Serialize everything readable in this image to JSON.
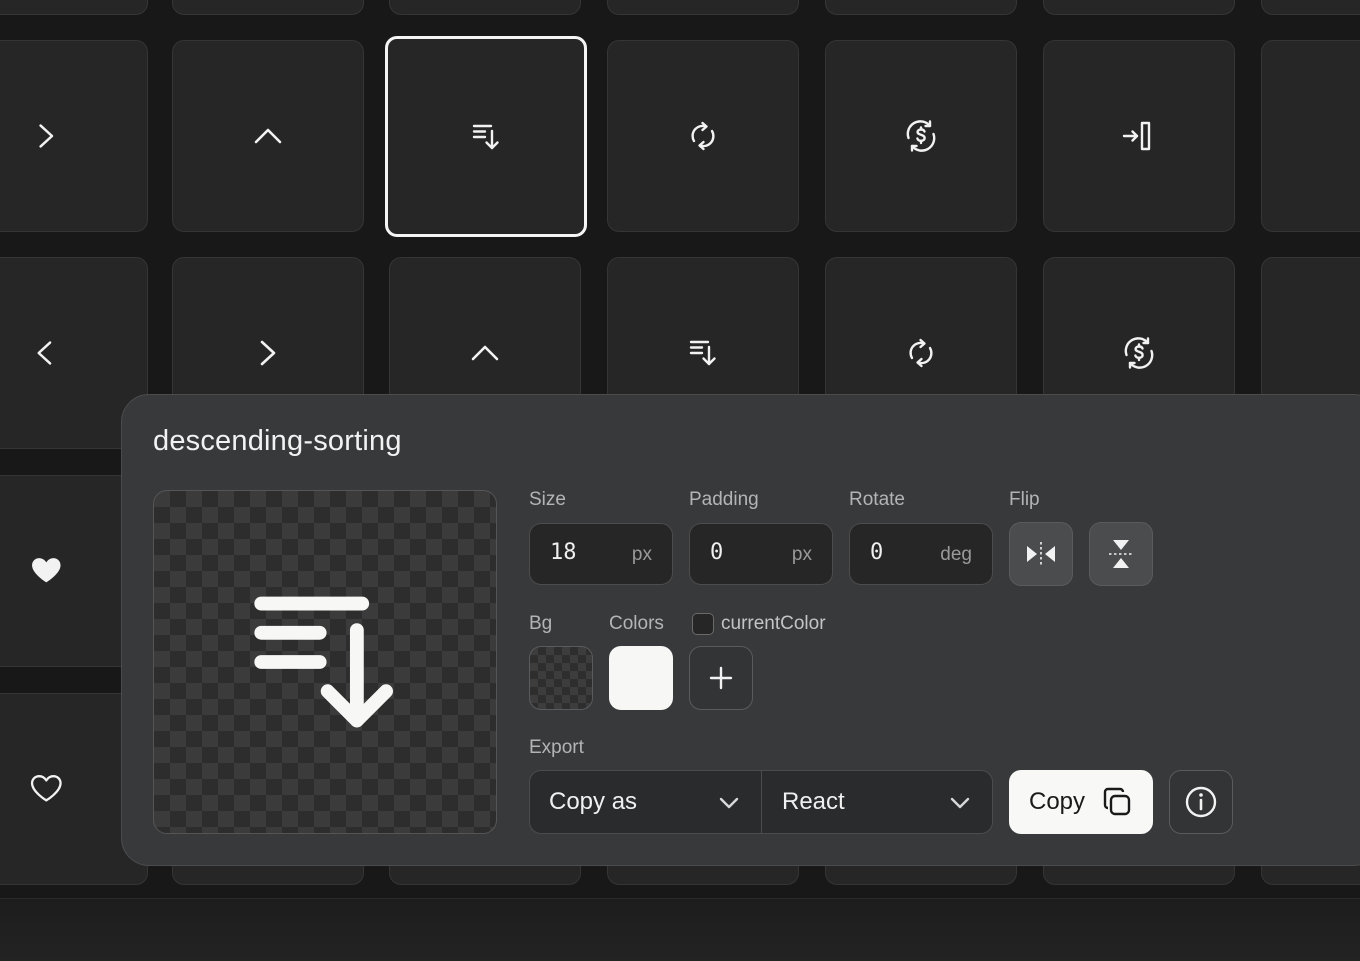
{
  "panel": {
    "title": "descending-sorting",
    "size": {
      "label": "Size",
      "value": "18",
      "unit": "px"
    },
    "padding": {
      "label": "Padding",
      "value": "0",
      "unit": "px"
    },
    "rotate": {
      "label": "Rotate",
      "value": "0",
      "unit": "deg"
    },
    "flip": {
      "label": "Flip",
      "horizontal_icon": "flip-horizontal-icon",
      "vertical_icon": "flip-vertical-icon"
    },
    "bg": {
      "label": "Bg",
      "value": "transparent"
    },
    "colors": {
      "label": "Colors",
      "swatch": "#F7F7F5"
    },
    "current_color": {
      "label": "currentColor",
      "checked": false
    },
    "export": {
      "label": "Export",
      "copy_as": "Copy as",
      "format": "React",
      "copy_label": "Copy"
    }
  },
  "grid": {
    "row1": [
      "chevron-right-icon",
      "chevron-up-icon",
      "descending-sorting-icon",
      "refresh-icon",
      "dollar-sync-icon",
      "login-icon"
    ],
    "row2": [
      "chevron-left-icon",
      "chevron-right-icon",
      "chevron-up-icon",
      "descending-sorting-icon",
      "refresh-icon",
      "dollar-sync-icon"
    ],
    "left_column": [
      "heart-filled-icon",
      "heart-outline-icon"
    ],
    "selected": "descending-sorting"
  }
}
